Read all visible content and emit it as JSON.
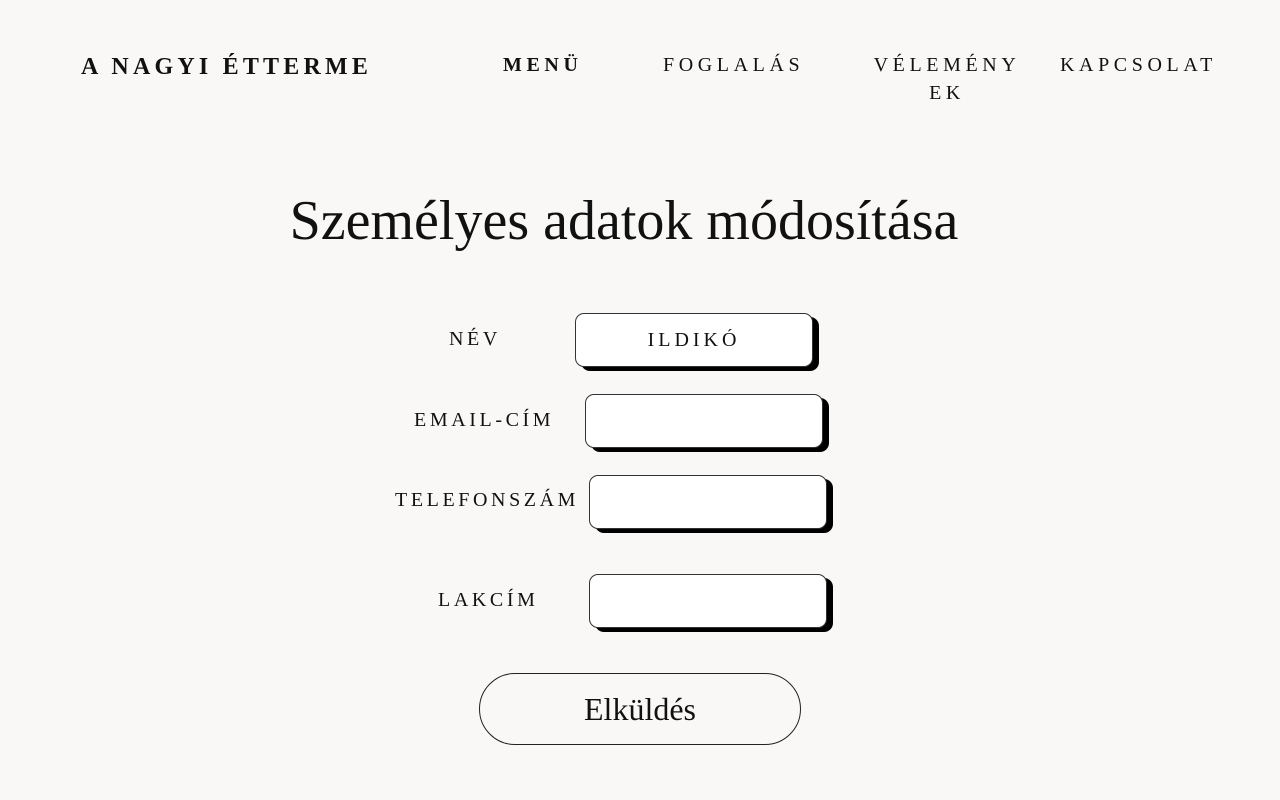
{
  "header": {
    "brand": "A NAGYI ÉTTERME",
    "nav": {
      "menu": "MENÜ",
      "booking": "FOGLALÁS",
      "reviews_line1": "VÉLEMÉNY",
      "reviews_line2": "EK",
      "contact": "KAPCSOLAT"
    }
  },
  "main": {
    "title": "Személyes adatok módosítása",
    "form": {
      "name_label": "NÉV",
      "name_value": "ILDIKÓ",
      "email_label": "EMAIL-CÍM",
      "email_value": "",
      "phone_label": "TELEFONSZÁM",
      "phone_value": "",
      "address_label": "LAKCÍM",
      "address_value": "",
      "submit_label": "Elküldés"
    }
  },
  "colors": {
    "background": "#f9f8f6",
    "text": "#111111",
    "input_background": "#ffffff",
    "input_shadow": "#000000"
  }
}
